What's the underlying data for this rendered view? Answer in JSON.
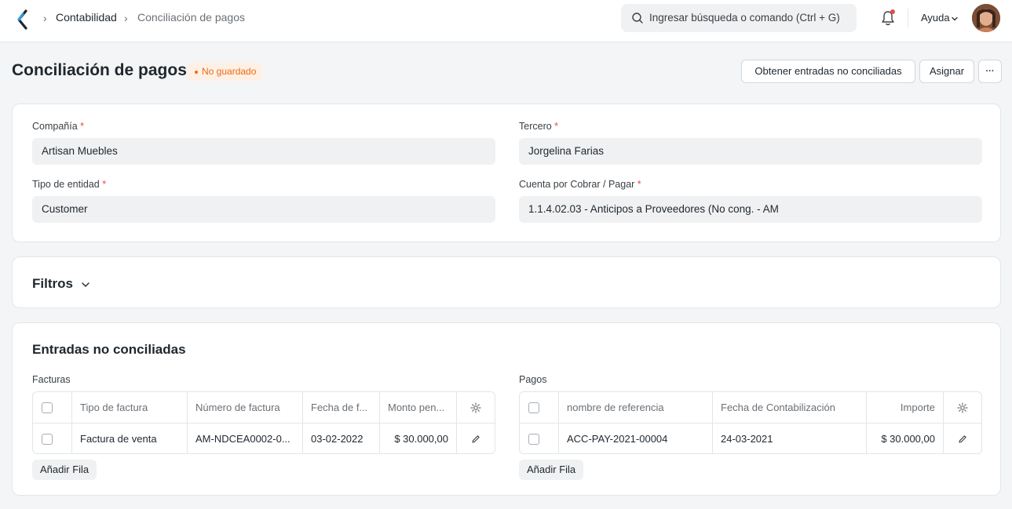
{
  "navbar": {
    "breadcrumbs": [
      "Contabilidad",
      "Conciliación de pagos"
    ],
    "search_placeholder": "Ingresar búsqueda o comando (Ctrl + G)",
    "help_label": "Ayuda"
  },
  "page": {
    "title": "Conciliación de pagos",
    "status": "No guardado",
    "btn_get_entries": "Obtener entradas no conciliadas",
    "btn_assign": "Asignar",
    "btn_more": "···"
  },
  "form": {
    "company": {
      "label": "Compañía",
      "value": "Artisan Muebles"
    },
    "party": {
      "label": "Tercero",
      "value": "Jorgelina Farias"
    },
    "party_type": {
      "label": "Tipo de entidad",
      "value": "Customer"
    },
    "account": {
      "label": "Cuenta por Cobrar / Pagar",
      "value": "1.1.4.02.03 - Anticipos a Proveedores (No cong. - AM"
    },
    "required_mark": "*"
  },
  "filters": {
    "title": "Filtros"
  },
  "unreconciled": {
    "title": "Entradas no conciliadas",
    "invoices": {
      "label": "Facturas",
      "columns": [
        "Tipo de factura",
        "Número de factura",
        "Fecha de f...",
        "Monto pen..."
      ],
      "rows": [
        {
          "type": "Factura de venta",
          "number": "AM-NDCEA0002-0...",
          "date": "03-02-2022",
          "amount": "$ 30.000,00"
        }
      ],
      "add_row": "Añadir Fila"
    },
    "payments": {
      "label": "Pagos",
      "columns": [
        "nombre de referencia",
        "Fecha de Contabilización",
        "Importe"
      ],
      "rows": [
        {
          "reference": "ACC-PAY-2021-00004",
          "date": "24-03-2021",
          "amount": "$ 30.000,00"
        }
      ],
      "add_row": "Añadir Fila"
    }
  }
}
